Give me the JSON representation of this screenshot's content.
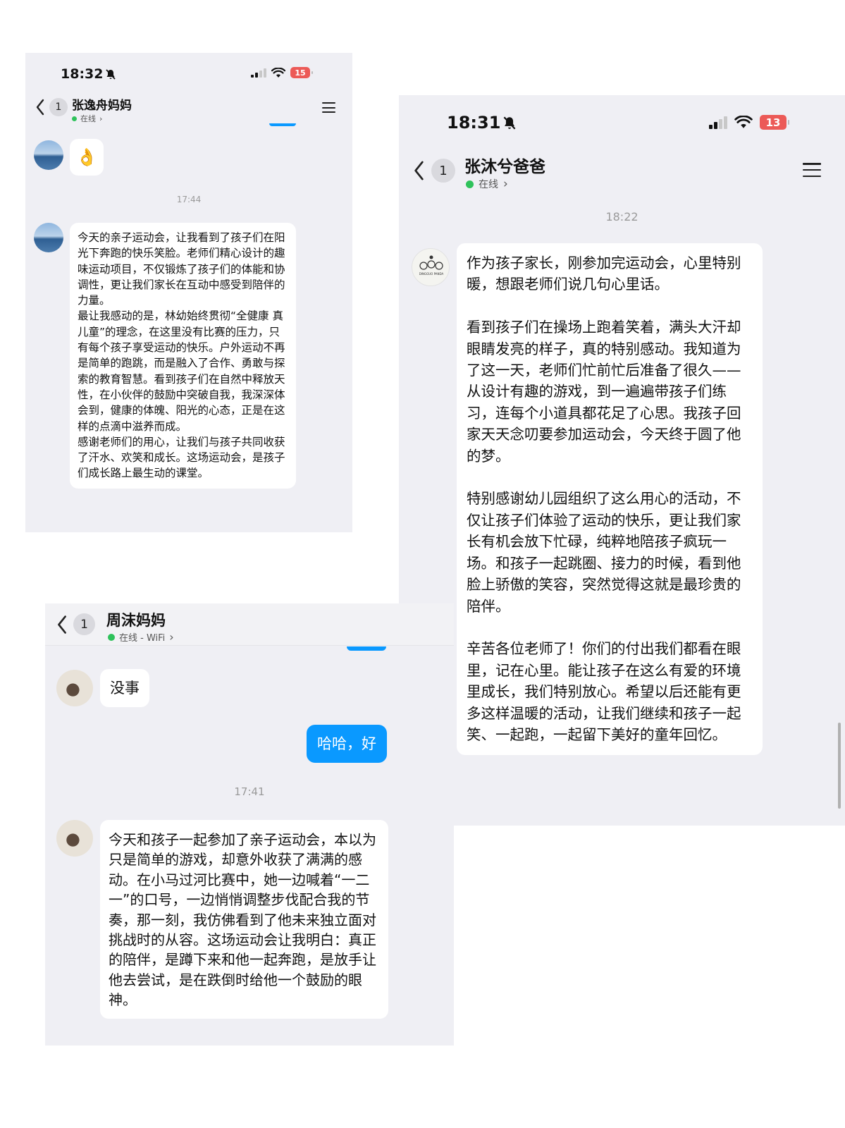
{
  "chat1": {
    "status_time": "18:32",
    "battery": "15",
    "back_count": "1",
    "contact_name": "张逸舟妈妈",
    "status": "在线",
    "emoji_message": "👌",
    "timestamp": "17:44",
    "message": "今天的亲子运动会，让我看到了孩子们在阳光下奔跑的快乐笑脸。老师们精心设计的趣味运动项目，不仅锻炼了孩子们的体能和协调性，更让我们家长在互动中感受到陪伴的力量。\n最让我感动的是，林幼始终贯彻“全健康 真儿童”的理念，在这里没有比赛的压力，只有每个孩子享受运动的快乐。户外运动不再是简单的跑跳，而是融入了合作、勇敢与探索的教育智慧。看到孩子们在自然中释放天性，在小伙伴的鼓励中突破自我，我深深体会到，健康的体魄、阳光的心态，正是在这样的点滴中滋养而成。\n感谢老师们的用心，让我们与孩子共同收获了汗水、欢笑和成长。这场运动会，是孩子们成长路上最生动的课堂。"
  },
  "chat2": {
    "status_time": "18:31",
    "battery": "13",
    "back_count": "1",
    "contact_name": "张沐兮爸爸",
    "status": "在线",
    "timestamp": "18:22",
    "avatar_text": "DINGGUO PANDA",
    "message": "作为孩子家长，刚参加完运动会，心里特别暖，想跟老师们说几句心里话。\n\n看到孩子们在操场上跑着笑着，满头大汗却眼睛发亮的样子，真的特别感动。我知道为了这一天，老师们忙前忙后准备了很久——从设计有趣的游戏，到一遍遍带孩子们练习，连每个小道具都花足了心思。我孩子回家天天念叨要参加运动会，今天终于圆了他的梦。\n\n特别感谢幼儿园组织了这么用心的活动，不仅让孩子们体验了运动的快乐，更让我们家长有机会放下忙碌，纯粹地陪孩子疯玩一场。和孩子一起跳圈、接力的时候，看到他脸上骄傲的笑容，突然觉得这就是最珍贵的陪伴。\n\n辛苦各位老师了！你们的付出我们都看在眼里，记在心里。能让孩子在这么有爱的环境里成长，我们特别放心。希望以后还能有更多这样温暖的活动，让我们继续和孩子一起笑、一起跑，一起留下美好的童年回忆。"
  },
  "chat3": {
    "back_count": "1",
    "contact_name": "周沫妈妈",
    "status": "在线 - WiFi",
    "msg_no_problem": "没事",
    "msg_haha": "哈哈，好",
    "timestamp": "17:41",
    "message": "今天和孩子一起参加了亲子运动会，本以为只是简单的游戏，却意外收获了满满的感动。在小马过河比赛中，她一边喊着“一二一”的口号，一边悄悄调整步伐配合我的节奏，那一刻，我仿佛看到了他未来独立面对挑战时的从容。这场运动会让我明白：真正的陪伴，是蹲下来和他一起奔跑，是放手让他去尝试，是在跌倒时给他一个鼓励的眼神。"
  },
  "icons": [
    "mute-bell-icon",
    "signal-icon",
    "wifi-icon",
    "battery-icon",
    "back-chevron-icon",
    "menu-icon",
    "chevron-right-icon"
  ],
  "colors": {
    "accent_blue": "#0a99ff",
    "online_green": "#2fc25b",
    "battery_red": "#ec5a57",
    "chat_bg": "#efeff4"
  }
}
